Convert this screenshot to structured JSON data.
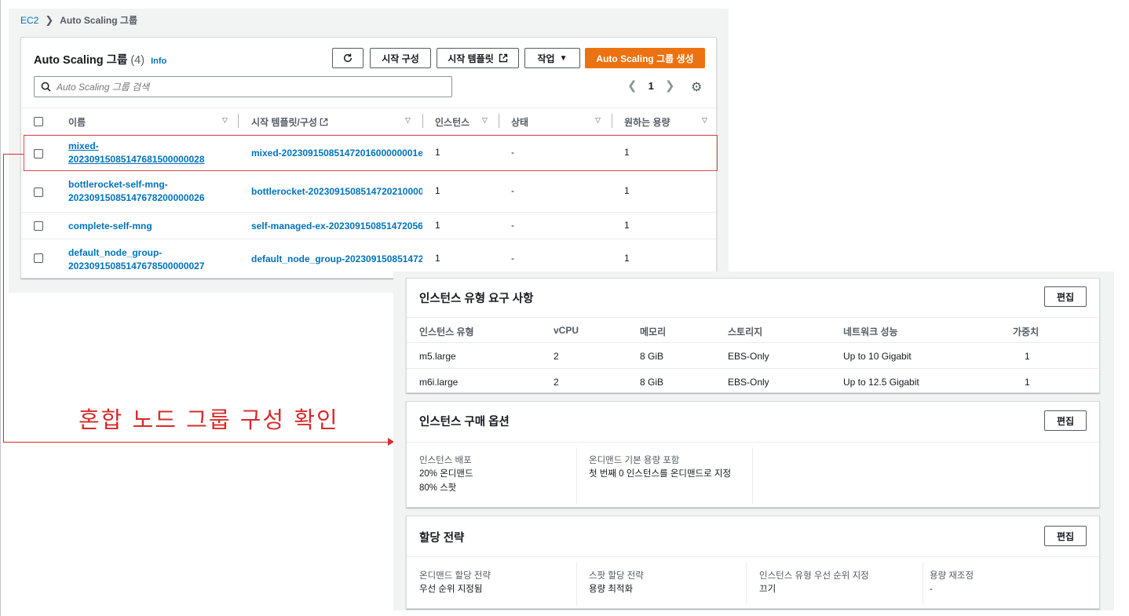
{
  "breadcrumb": {
    "root": "EC2",
    "current": "Auto Scaling 그룹"
  },
  "asg_panel": {
    "title": "Auto Scaling 그룹",
    "count": "(4)",
    "info": "Info",
    "buttons": {
      "refresh_icon": "refresh-icon",
      "launch_config": "시작 구성",
      "launch_template": "시작 템플릿",
      "actions": "작업",
      "create": "Auto Scaling 그룹 생성"
    },
    "search_placeholder": "Auto Scaling 그룹 검색",
    "page": "1",
    "columns": [
      "이름",
      "시작 템플릿/구성",
      "인스턴스",
      "상태",
      "원하는 용량"
    ],
    "rows": [
      {
        "name_line1": "mixed-",
        "name_line2": "20230915085147681500000028",
        "template": "mixed-20230915085147201600000001e",
        "instances": "1",
        "status": "-",
        "desired": "1"
      },
      {
        "name_line1": "bottlerocket-self-mng-",
        "name_line2": "20230915085147678200000026",
        "template": "bottlerocket-20230915085147202100000",
        "instances": "1",
        "status": "-",
        "desired": "1"
      },
      {
        "name_line1": "complete-self-mng",
        "name_line2": "",
        "template": "self-managed-ex-202309150851472056",
        "instances": "1",
        "status": "-",
        "desired": "1"
      },
      {
        "name_line1": "default_node_group-",
        "name_line2": "20230915085147678500000027",
        "template": "default_node_group-202309150851472",
        "instances": "1",
        "status": "-",
        "desired": "1"
      }
    ]
  },
  "annotation": {
    "text": "혼합 노드 그룹 구성 확인",
    "color": "#d92b2b"
  },
  "instance_type_requirements": {
    "title": "인스턴스 유형 요구 사항",
    "edit": "편집",
    "columns": [
      "인스턴스 유형",
      "vCPU",
      "메모리",
      "스토리지",
      "네트워크 성능",
      "가중치"
    ],
    "rows": [
      [
        "m5.large",
        "2",
        "8 GiB",
        "EBS-Only",
        "Up to 10 Gigabit",
        "1"
      ],
      [
        "m6i.large",
        "2",
        "8 GiB",
        "EBS-Only",
        "Up to 12.5 Gigabit",
        "1"
      ]
    ]
  },
  "purchase_options": {
    "title": "인스턴스 구매 옵션",
    "edit": "편집",
    "distribution_label": "인스턴스 배포",
    "distribution_ondemand": "20% 온디맨드",
    "distribution_spot": "80% 스팟",
    "base_label": "온디맨드 기본 용량 포함",
    "base_value": "첫 번째 0 인스턴스를 온디맨드로 지정"
  },
  "allocation_strategy": {
    "title": "할당 전략",
    "edit": "편집",
    "items": [
      {
        "label": "온디맨드 할당 전략",
        "value": "우선 순위 지정됨"
      },
      {
        "label": "스팟 할당 전략",
        "value": "용량 최적화"
      },
      {
        "label": "인스턴스 유형 우선 순위 지정",
        "value": "끄기"
      },
      {
        "label": "용량 재조정",
        "value": "-"
      }
    ]
  },
  "colors": {
    "link": "#0073bb",
    "primary": "#ec7211",
    "highlight": "#e3474a"
  }
}
